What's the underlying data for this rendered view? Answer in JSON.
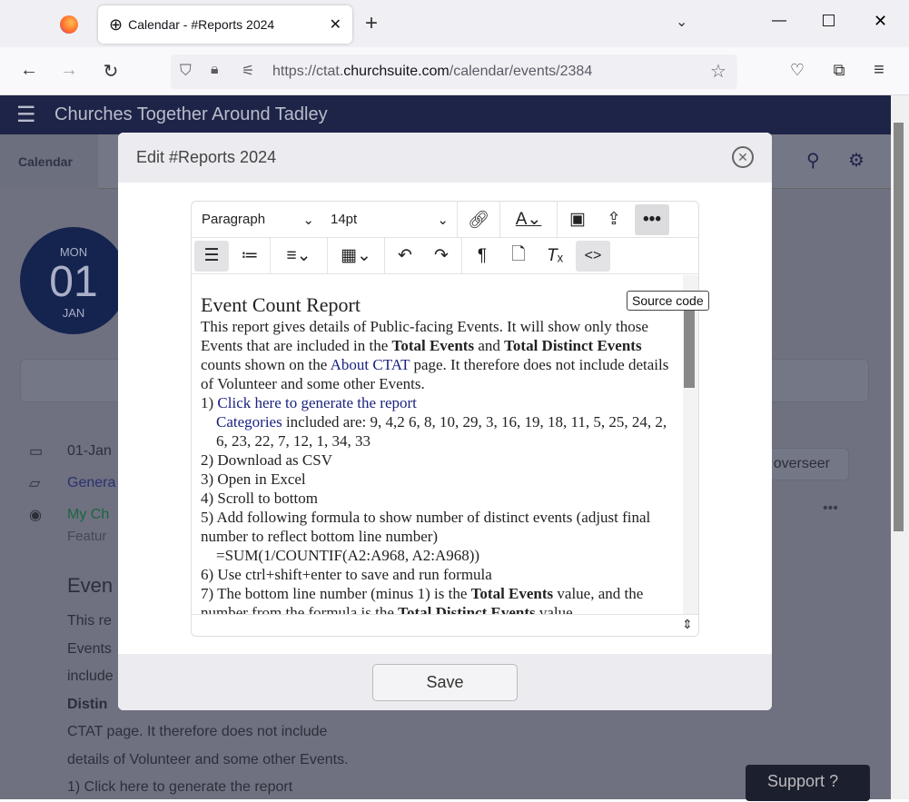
{
  "browser": {
    "tab_title": "Calendar - #Reports 2024",
    "url_prefix": "https://ctat.",
    "url_domain": "churchsuite.com",
    "url_path": "/calendar/events/2384"
  },
  "app": {
    "title": "Churches Together Around Tadley",
    "nav_calendar": "Calendar",
    "date_badge": {
      "day": "MON",
      "date": "01",
      "month": "JAN"
    },
    "details": [
      "01-Jan",
      "Genera",
      "My Ch",
      "Featur"
    ],
    "add_overseer": "Add overseer",
    "support": "Support",
    "bg_heading": "Even",
    "bg_lines": [
      "This re",
      "Events",
      "include",
      "Distin",
      "CTAT page.  It therefore does not include",
      "details of Volunteer and some other Events.",
      "1) Click here to generate the report"
    ]
  },
  "modal": {
    "title": "Edit #Reports 2024",
    "save_label": "Save",
    "toolbar": {
      "block_format": "Paragraph",
      "font_size": "14pt",
      "tooltip": "Source code"
    },
    "content": {
      "heading": "Event Count Report",
      "p1a": "This report gives details of Public-facing Events.  It will show only those Events that are included in the ",
      "p1b": "Total Events",
      "p1c": " and ",
      "p1d": "Total Distinct Events",
      "p1e": " counts shown on the ",
      "p1link": "About CTAT",
      "p1f": " page.  It therefore does not include details of Volunteer and some other Events.",
      "s1a": "1) ",
      "s1link": "Click here to generate the report",
      "cat_link": "Categories",
      "cat_text": " included are: 9, 4,2 6, 8, 10, 29, 3, 16, 19, 18, 11, 5, 25, 24, 2, 6, 23, 22, 7, 12, 1, 34, 33",
      "s2": "2) Download as CSV",
      "s3": "3) Open in Excel",
      "s4": "4) Scroll to bottom",
      "s5": "5) Add following formula to show number of distinct events (adjust final number to reflect bottom line number)",
      "formula": "=SUM(1/COUNTIF(A2:A968, A2:A968))",
      "s6": "6) Use ctrl+shift+enter to save and run formula",
      "s7a": "7) The bottom line number (minus 1) is the ",
      "s7b": "Total Events",
      "s7c": " value, and the number from the formula is the ",
      "s7d": "Total Distinct Events",
      "s7e": " value."
    }
  }
}
